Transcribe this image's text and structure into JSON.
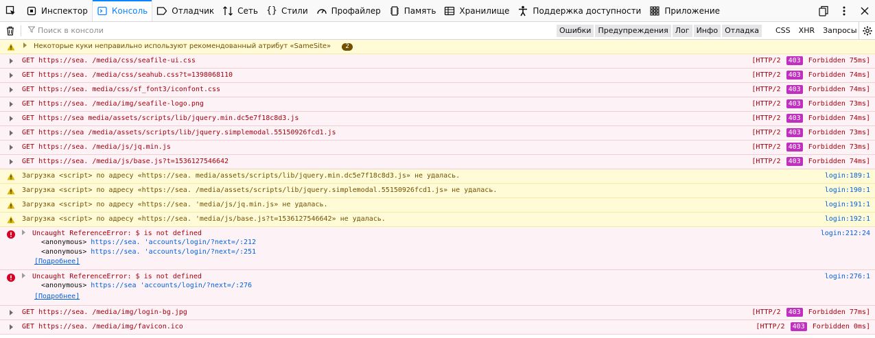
{
  "toolbar": {
    "tabs": [
      {
        "label": "Инспектор",
        "icon": "inspector-icon"
      },
      {
        "label": "Консоль",
        "icon": "console-icon"
      },
      {
        "label": "Отладчик",
        "icon": "debugger-icon"
      },
      {
        "label": "Сеть",
        "icon": "network-icon"
      },
      {
        "label": "Стили",
        "icon": "style-editor-icon"
      },
      {
        "label": "Профайлер",
        "icon": "profiler-icon"
      },
      {
        "label": "Память",
        "icon": "memory-icon"
      },
      {
        "label": "Хранилище",
        "icon": "storage-icon"
      },
      {
        "label": "Поддержка доступности",
        "icon": "accessibility-icon"
      },
      {
        "label": "Приложение",
        "icon": "application-icon"
      }
    ],
    "active_tab": "Консоль"
  },
  "filter": {
    "placeholder": "Поиск в консоли",
    "levels": [
      "Ошибки",
      "Предупреждения",
      "Лог",
      "Инфо",
      "Отладка"
    ],
    "categories": [
      "CSS",
      "XHR",
      "Запросы"
    ]
  },
  "messages": {
    "cookie_warning": {
      "text": "Некоторые куки неправильно используют рекомендованный атрибут «SameSite»",
      "count": "2"
    },
    "net": [
      {
        "text": "GET https://sea.       /media/css/seafile-ui.css",
        "proto": "[HTTP/2",
        "code": "403",
        "status": "Forbidden 75ms]"
      },
      {
        "text": "GET https://sea.      /media/css/seahub.css?t=1398068110",
        "proto": "[HTTP/2",
        "code": "403",
        "status": "Forbidden 74ms]"
      },
      {
        "text": "GET https://sea.       media/css/sf_font3/iconfont.css",
        "proto": "[HTTP/2",
        "code": "403",
        "status": "Forbidden 74ms]"
      },
      {
        "text": "GET https://sea.        /media/img/seafile-logo.png",
        "proto": "[HTTP/2",
        "code": "403",
        "status": "Forbidden 73ms]"
      },
      {
        "text": "GET https://sea       media/assets/scripts/lib/jquery.min.dc5e7f18c8d3.js",
        "proto": "[HTTP/2",
        "code": "403",
        "status": "Forbidden 74ms]"
      },
      {
        "text": "GET https://sea       /media/assets/scripts/lib/jquery.simplemodal.55150926fcd1.js",
        "proto": "[HTTP/2",
        "code": "403",
        "status": "Forbidden 73ms]"
      },
      {
        "text": "GET https://sea.       /media/js/jq.min.js",
        "proto": "[HTTP/2",
        "code": "403",
        "status": "Forbidden 73ms]"
      },
      {
        "text": "GET https://sea.       /media/js/base.js?t=1536127546642",
        "proto": "[HTTP/2",
        "code": "403",
        "status": "Forbidden 74ms]"
      }
    ],
    "script_warnings": [
      {
        "text": "Загрузка <script> по адресу «https://sea.        media/assets/scripts/lib/jquery.min.dc5e7f18c8d3.js» не удалась.",
        "loc": "login:189:1"
      },
      {
        "text": "Загрузка <script> по адресу «https://sea.        /media/assets/scripts/lib/jquery.simplemodal.55150926fcd1.js» не удалась.",
        "loc": "login:190:1"
      },
      {
        "text": "Загрузка <script> по адресу «https://sea.         'media/js/jq.min.js» не удалась.",
        "loc": "login:191:1"
      },
      {
        "text": "Загрузка <script> по адресу «https://sea.         'media/js/base.js?t=1536127546642» не удалась.",
        "loc": "login:192:1"
      }
    ],
    "errors": [
      {
        "text": "Uncaught ReferenceError: $ is not defined",
        "loc": "login:212:24",
        "stack": [
          {
            "fn": "<anonymous>",
            "link": "https://sea.       'accounts/login/?next=/:212"
          },
          {
            "fn": "<anonymous>",
            "link": "https://sea.       'accounts/login/?next=/:251"
          }
        ],
        "more": "[Подробнее]"
      },
      {
        "text": "Uncaught ReferenceError: $ is not defined",
        "loc": "login:276:1",
        "stack": [
          {
            "fn": "<anonymous>",
            "link": "https://sea       'accounts/login/?next=/:276"
          }
        ],
        "more": "[Подробнее]"
      }
    ],
    "net_tail": [
      {
        "text": "GET https://sea.       /media/img/login-bg.jpg",
        "proto": "[HTTP/2",
        "code": "403",
        "status": "Forbidden 77ms]"
      },
      {
        "text": "GET https://sea.       /media/img/favicon.ico",
        "proto": "[HTTP/2",
        "code": "403",
        "status": "Forbidden 0ms]"
      }
    ]
  },
  "colors": {
    "accent": "#0a84ff",
    "error_text": "#a4000f",
    "warning_text": "#715100",
    "status_code": "#c030be",
    "link": "#0060df"
  }
}
